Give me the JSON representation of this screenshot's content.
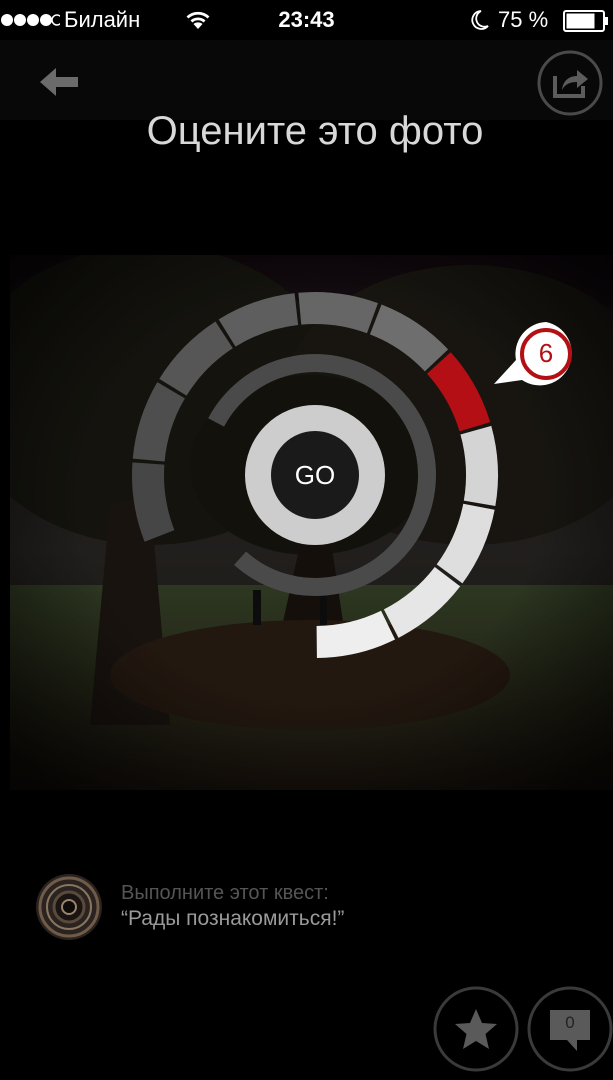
{
  "status_bar": {
    "carrier": "Билайн",
    "time": "23:43",
    "battery": "75 %"
  },
  "header": {
    "title": "Оцените это фото"
  },
  "rating": {
    "go_label": "GO",
    "selected_value": "6",
    "selected_index": 6,
    "segment_count": 11,
    "accent_color": "#b30f14"
  },
  "quest": {
    "label": "Выполните этот квест:",
    "name": "“Рады познакомиться!”"
  },
  "actions": {
    "comment_count": "0"
  },
  "icons": {
    "back": "arrow-left-icon",
    "share": "share-icon",
    "star": "star-icon",
    "comment": "comment-icon",
    "wifi": "wifi-icon",
    "moon": "moon-icon",
    "battery": "battery-icon"
  }
}
